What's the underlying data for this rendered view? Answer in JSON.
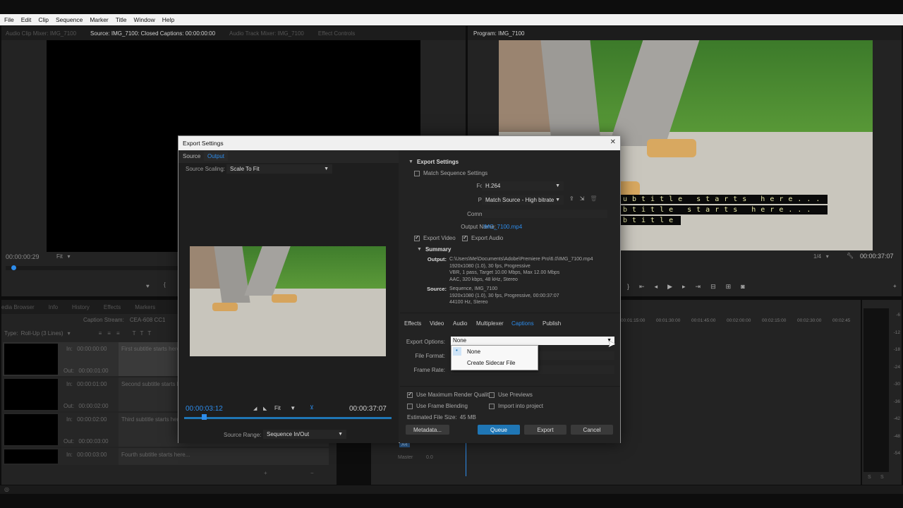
{
  "menu": [
    "File",
    "Edit",
    "Clip",
    "Sequence",
    "Marker",
    "Title",
    "Window",
    "Help"
  ],
  "source_panel": {
    "tabs": [
      "Audio Clip Mixer: IMG_7100",
      "Source: IMG_7100: Closed Captions: 00:00:00:00",
      "Audio Track Mixer: IMG_7100",
      "Effect Controls"
    ],
    "timecode": "00:00:00:29",
    "fit": "Fit"
  },
  "program_panel": {
    "title": "Program: IMG_7100",
    "timecode": "00:00:37:07",
    "zoom": "1/4",
    "captions": [
      "ubtitle starts here...",
      "btitle starts here...",
      "btitle"
    ]
  },
  "caption_panel": {
    "tabs": [
      "edia Browser",
      "Info",
      "History",
      "Effects",
      "Markers"
    ],
    "stream_label": "Caption Stream:",
    "stream_value": "CEA-608 CC1",
    "type_label": "Type:",
    "type_value": "Roll-Up (3 Lines)",
    "in_label": "In:",
    "out_label": "Out:",
    "items": [
      {
        "in": "00:00:00:00",
        "out": "00:00:01:00",
        "text": "First subtitle starts here..."
      },
      {
        "in": "00:00:01:00",
        "out": "00:00:02:00",
        "text": "Second subtitle starts he..."
      },
      {
        "in": "00:00:02:00",
        "out": "00:00:03:00",
        "text": "Third subtitle starts here..."
      },
      {
        "in": "00:00:03:00",
        "out": "",
        "text": "Fourth subtitle starts here..."
      }
    ]
  },
  "timeline": {
    "ruler": [
      "00:01:15:00",
      "00:01:30:00",
      "00:01:45:00",
      "00:02:00:00",
      "00:02:15:00",
      "00:02:30:00",
      "00:02:45"
    ],
    "track": "A4",
    "master_label": "Master",
    "master_value": "0.0"
  },
  "meter": {
    "labels": [
      "-6",
      "-12",
      "-18",
      "-24",
      "-30",
      "-36",
      "-42",
      "-48",
      "-54"
    ],
    "solo": [
      "S",
      "S"
    ]
  },
  "dialog": {
    "title": "Export Settings",
    "close": "✕",
    "tabs": {
      "source": "Source",
      "output": "Output"
    },
    "source_scaling_label": "Source Scaling:",
    "source_scaling_value": "Scale To Fit",
    "current_time": "00:00:03:12",
    "duration": "00:00:37:07",
    "fit": "Fit",
    "source_range_label": "Source Range:",
    "source_range_value": "Sequence In/Out",
    "settings": {
      "header": "Export Settings",
      "match_sequence": "Match Sequence Settings",
      "format_label": "Format:",
      "format_value": "H.264",
      "preset_label": "Preset:",
      "preset_value": "Match Source - High bitrate",
      "comments_label": "Comments:",
      "output_name_label": "Output Name:",
      "output_name_value": "IMG_7100.mp4",
      "export_video": "Export Video",
      "export_audio": "Export Audio",
      "summary_header": "Summary",
      "output_label": "Output:",
      "output_lines": [
        "C:\\Users\\Me\\Documents\\Adobe\\Premiere Pro\\6.0\\IMG_7100.mp4",
        "1920x1080 (1.0), 30 fps, Progressive",
        "VBR, 1 pass, Target 10.00 Mbps, Max 12.00 Mbps",
        "AAC, 320 kbps, 48 kHz, Stereo"
      ],
      "source_label": "Source:",
      "source_lines": [
        "Sequence, IMG_7100",
        "1920x1080 (1.0), 30 fps, Progressive, 00:00:37:07",
        "44100 Hz, Stereo"
      ]
    },
    "subtabs": [
      "Effects",
      "Video",
      "Audio",
      "Multiplexer",
      "Captions",
      "Publish"
    ],
    "captions": {
      "export_options_label": "Export Options:",
      "export_options_value": "None",
      "file_format_label": "File Format:",
      "frame_rate_label": "Frame Rate:",
      "dropdown_options": [
        "None",
        "Create Sidecar File"
      ]
    },
    "bottom": {
      "max_render": "Use Maximum Render Quality",
      "use_previews": "Use Previews",
      "frame_blending": "Use Frame Blending",
      "import_project": "Import into project",
      "file_size_label": "Estimated File Size:",
      "file_size_value": "45 MB",
      "metadata": "Metadata...",
      "queue": "Queue",
      "export": "Export",
      "cancel": "Cancel"
    }
  }
}
